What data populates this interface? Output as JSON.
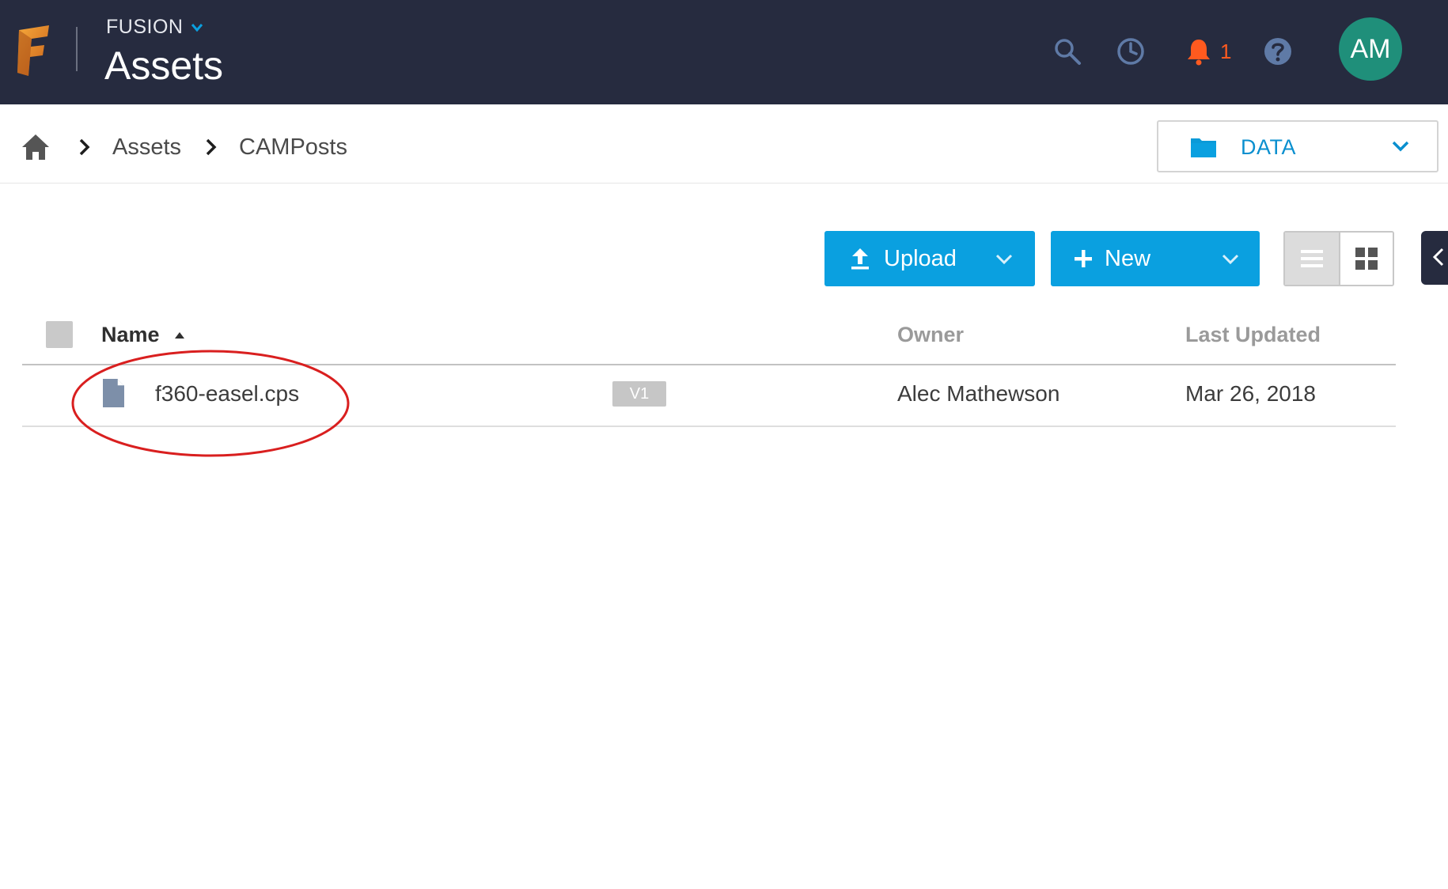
{
  "header": {
    "app_name": "FUSION",
    "title": "Assets",
    "notification_count": "1",
    "avatar_initials": "AM",
    "icons": [
      "fusion-logo-icon",
      "search-icon",
      "history-icon",
      "bell-icon",
      "help-icon"
    ]
  },
  "breadcrumb": {
    "items": [
      "Assets",
      "CAMPosts"
    ]
  },
  "data_selector": {
    "label": "DATA"
  },
  "toolbar": {
    "upload_label": "Upload",
    "new_label": "New"
  },
  "table": {
    "columns": {
      "name": "Name",
      "owner": "Owner",
      "last_updated": "Last Updated"
    },
    "sort": {
      "column": "Name",
      "direction": "ascending"
    },
    "rows": [
      {
        "name": "f360-easel.cps",
        "version": "V1",
        "owner": "Alec Mathewson",
        "last_updated": "Mar 26, 2018"
      }
    ]
  },
  "colors": {
    "header_bg": "#262b3f",
    "accent_blue": "#0aa0e0",
    "notification": "#ff5a1f",
    "avatar_bg": "#1f8f7a",
    "annotation": "#d91f1f"
  }
}
